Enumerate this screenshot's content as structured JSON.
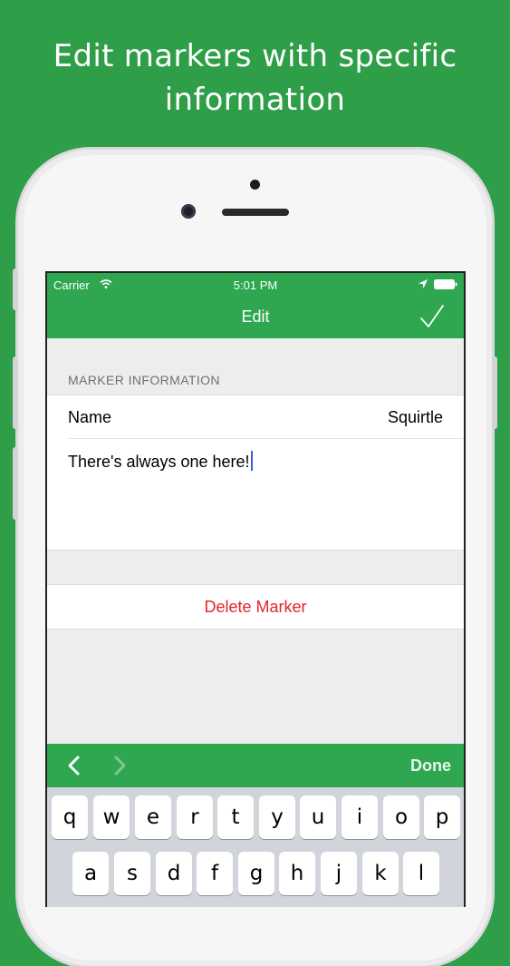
{
  "headline": [
    "Edit markers with specific",
    "information"
  ],
  "status_bar": {
    "carrier": "Carrier",
    "time": "5:01 PM"
  },
  "nav": {
    "title": "Edit"
  },
  "section": {
    "label": "MARKER INFORMATION"
  },
  "form": {
    "name_label": "Name",
    "name_value": "Squirtle",
    "notes_value": "There's always one here!"
  },
  "actions": {
    "delete_label": "Delete Marker"
  },
  "keyboard_accessory": {
    "done_label": "Done"
  },
  "keyboard": {
    "row1": [
      "q",
      "w",
      "e",
      "r",
      "t",
      "y",
      "u",
      "i",
      "o",
      "p"
    ],
    "row2": [
      "a",
      "s",
      "d",
      "f",
      "g",
      "h",
      "j",
      "k",
      "l"
    ]
  },
  "colors": {
    "background": "#2e9e48",
    "bar": "#2ea750",
    "delete": "#e3242b",
    "caret": "#3b5bdb"
  },
  "icons": [
    "wifi-icon",
    "location-arrow-icon",
    "battery-icon",
    "checkmark-icon",
    "chevron-left-icon",
    "chevron-right-icon"
  ]
}
